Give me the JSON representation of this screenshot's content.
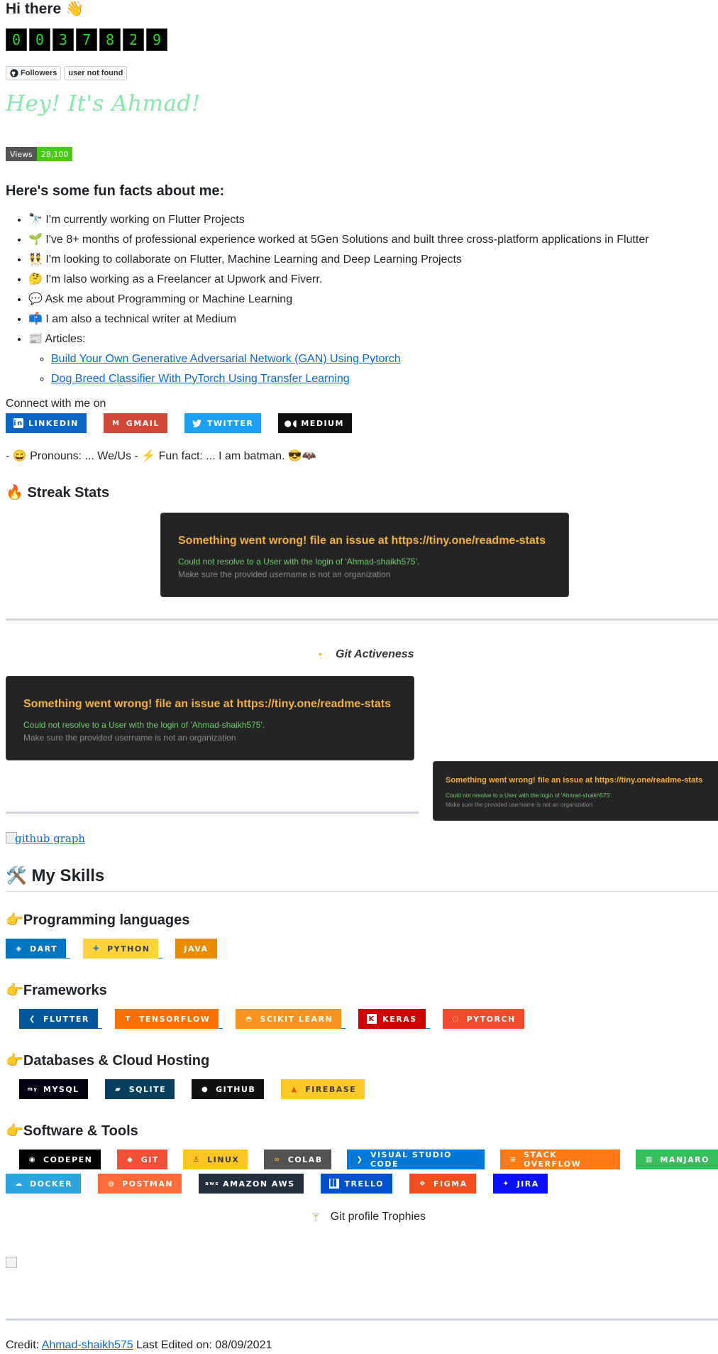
{
  "header": {
    "greeting": "Hi there 👋",
    "digits": [
      "0",
      "0",
      "3",
      "7",
      "8",
      "2",
      "9"
    ]
  },
  "github_badges": {
    "followers": "Followers",
    "status": "user not found"
  },
  "hey": "Hey! It's Ahmad!",
  "views": {
    "label": "Views",
    "count": "28,100"
  },
  "fun_facts": {
    "heading": "Here's some fun facts about me:",
    "items": [
      "🔭 I'm currently working on Flutter Projects",
      "🌱 I've 8+ months of professional experience worked at 5Gen Solutions and built three cross-platform applications in Flutter",
      "👯 I'm looking to collaborate on Flutter, Machine Learning and Deep Learning Projects",
      "🤔 I'm lalso working as a Freelancer at Upwork and Fiverr.",
      "💬 Ask me about Programming or Machine Learning",
      "📫 I am also a technical writer at Medium",
      "📰 Articles:"
    ],
    "articles": [
      "Build Your Own Generative Adversarial Network (GAN) Using Pytorch",
      "Dog Breed Classifier With PyTorch Using Transfer Learning"
    ]
  },
  "connect": {
    "label": "Connect with me on",
    "buttons": [
      {
        "label": "LINKEDIN",
        "color": "#0a66c2",
        "icon": "linkedin-icon"
      },
      {
        "label": "GMAIL",
        "color": "#d14836",
        "icon": "gmail-icon"
      },
      {
        "label": "TWITTER",
        "color": "#1da1f2",
        "icon": "twitter-icon"
      },
      {
        "label": "MEDIUM",
        "color": "#12100e",
        "icon": "medium-icon"
      }
    ]
  },
  "pronouns": "- 😄 Pronouns: ... We/Us - ⚡ Fun fact: ... I am batman. 😎🦇",
  "streak": {
    "heading": "🔥 Streak Stats"
  },
  "error": {
    "title": "Something went wrong! file an issue at https://tiny.one/readme-stats",
    "line1": "Could not resolve to a User with the login of 'Ahmad-shaikh575'.",
    "line2": "Make sure the provided username is not an organization"
  },
  "git_activeness": "Git Activeness",
  "github_graph_alt": "github graph",
  "skills": {
    "heading": "🛠️ My Skills",
    "languages_heading": "👉Programming languages",
    "languages": [
      {
        "label": "DART",
        "color": "#0175c2",
        "icon": "dart-icon"
      },
      {
        "label": "PYTHON",
        "color": "#ffd43b",
        "text": "#3b3b3b",
        "icon": "python-icon"
      },
      {
        "label": "JAVA",
        "color": "#ed8b00",
        "icon": "java-icon"
      }
    ],
    "frameworks_heading": "👉Frameworks",
    "frameworks": [
      {
        "label": "FLUTTER",
        "color": "#02569b",
        "icon": "flutter-icon"
      },
      {
        "label": "TENSORFLOW",
        "color": "#ff6f00",
        "icon": "tensorflow-icon"
      },
      {
        "label": "SCIKIT LEARN",
        "color": "#f7931e",
        "icon": "scikit-learn-icon"
      },
      {
        "label": "KERAS",
        "color": "#d00000",
        "icon": "keras-icon"
      },
      {
        "label": "PYTORCH",
        "color": "#ee4c2c",
        "icon": "pytorch-icon"
      }
    ],
    "databases_heading": "👉Databases & Cloud Hosting",
    "databases": [
      {
        "label": "MYSQL",
        "color": "#00000f",
        "icon": "mysql-icon"
      },
      {
        "label": "SQLITE",
        "color": "#07405e",
        "icon": "sqlite-icon"
      },
      {
        "label": "GITHUB",
        "color": "#121011",
        "icon": "github-icon"
      },
      {
        "label": "FIREBASE",
        "color": "#ffca28",
        "text": "#3b3b3b",
        "icon": "firebase-icon"
      }
    ],
    "tools_heading": "👉Software & Tools",
    "tools_row1": [
      {
        "label": "CODEPEN",
        "color": "#000000",
        "icon": "codepen-icon"
      },
      {
        "label": "GIT",
        "color": "#f05033",
        "icon": "git-icon"
      },
      {
        "label": "LINUX",
        "color": "#fcc624",
        "text": "#3b3b3b",
        "icon": "linux-icon"
      },
      {
        "label": "COLAB",
        "color": "#525252",
        "icon": "colab-icon"
      },
      {
        "label": "VISUAL STUDIO CODE",
        "color": "#0078d7",
        "icon": "vscode-icon"
      },
      {
        "label": "STACK OVERFLOW",
        "color": "#fe7a16",
        "icon": "stackoverflow-icon"
      },
      {
        "label": "MANJARO",
        "color": "#35bf5c",
        "icon": "manjaro-icon"
      }
    ],
    "tools_row2": [
      {
        "label": "DOCKER",
        "color": "#2ca5e0",
        "icon": "docker-icon"
      },
      {
        "label": "POSTMAN",
        "color": "#ff6c37",
        "icon": "postman-icon"
      },
      {
        "label": "AMAZON AWS",
        "color": "#232f3e",
        "icon": "aws-icon"
      },
      {
        "label": "TRELLO",
        "color": "#0052cc",
        "icon": "trello-icon"
      },
      {
        "label": "FIGMA",
        "color": "#f24e1e",
        "icon": "figma-icon"
      },
      {
        "label": "JIRA",
        "color": "#0a0fff",
        "icon": "jira-icon"
      }
    ]
  },
  "trophies": "Git profile Trophies",
  "footer": {
    "credit": "Credit:",
    "user": "Ahmad-shaikh575",
    "edited": "Last Edited on: 08/09/2021"
  }
}
